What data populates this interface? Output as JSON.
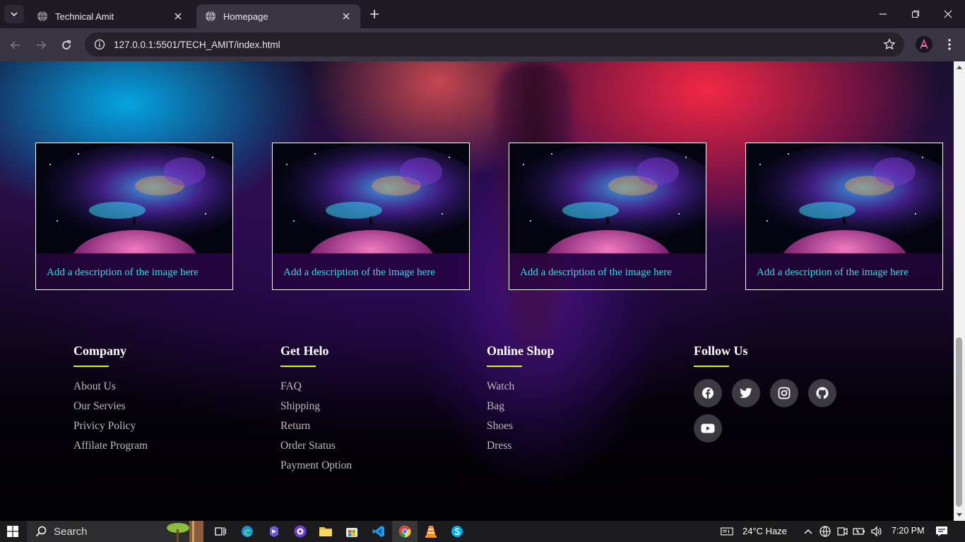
{
  "browser": {
    "tabs": [
      {
        "title": "Technical Amit",
        "active": false
      },
      {
        "title": "Homepage",
        "active": true
      }
    ],
    "url": "127.0.0.1:5501/TECH_AMIT/index.html",
    "profile_initial": "A"
  },
  "cards": [
    {
      "description": "Add a description of the image here"
    },
    {
      "description": "Add a description of the image here"
    },
    {
      "description": "Add a description of the image here"
    },
    {
      "description": "Add a description of the image here"
    }
  ],
  "footer": {
    "columns": [
      {
        "title": "Company",
        "links": [
          "About Us",
          "Our Servies",
          "Privicy Policy",
          "Affilate Program"
        ]
      },
      {
        "title": "Get Helo",
        "links": [
          "FAQ",
          "Shipping",
          "Return",
          "Order Status",
          "Payment Option"
        ]
      },
      {
        "title": "Online Shop",
        "links": [
          "Watch",
          "Bag",
          "Shoes",
          "Dress"
        ]
      },
      {
        "title": "Follow Us",
        "links": []
      }
    ],
    "social_icons": [
      "facebook-icon",
      "twitter-icon",
      "instagram-icon",
      "github-icon",
      "youtube-icon"
    ]
  },
  "taskbar": {
    "search_label": "Search",
    "weather": "24°C  Haze",
    "time": "7:20 PM"
  }
}
